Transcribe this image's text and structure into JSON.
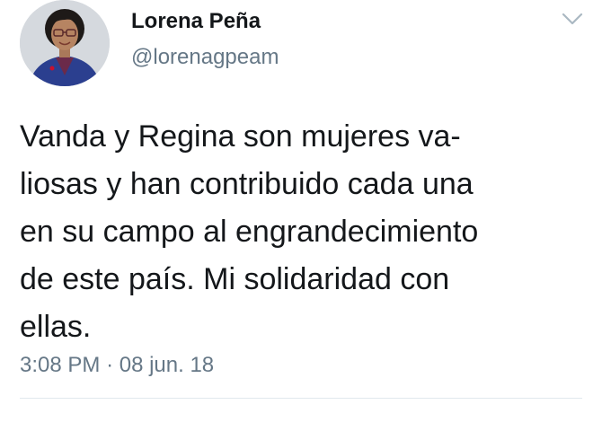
{
  "author": {
    "display_name": "Lorena Peña",
    "handle": "@lorenagpeam",
    "avatar_icon": "profile-photo"
  },
  "menu": {
    "icon": "chevron-down-icon"
  },
  "tweet": {
    "lines": [
      "Vanda y Regina son mujeres va-",
      "liosas y han contribuido cada una",
      "en su campo al engrandecimiento",
      "de este país. Mi solidaridad con",
      "ellas."
    ]
  },
  "meta": {
    "time": "3:08 PM",
    "separator": "·",
    "date": "08 jun. 18"
  },
  "colors": {
    "text": "#14171a",
    "secondary": "#657786",
    "divider": "#e1e8ed",
    "caret": "#aab8c2"
  }
}
